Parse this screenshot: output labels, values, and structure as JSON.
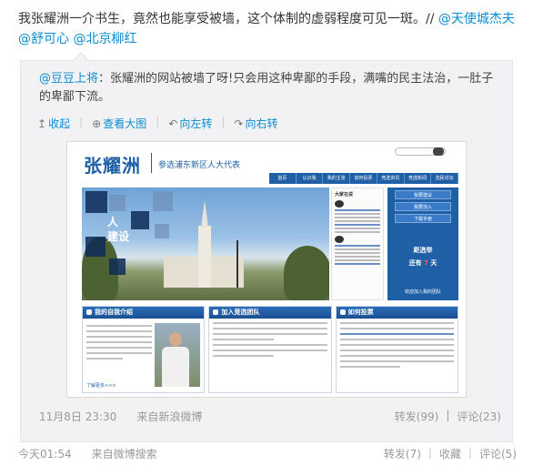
{
  "post": {
    "text": "我张耀洲一介书生，竟然也能享受被墙，这个体制的虚弱程度可见一斑。// ",
    "mention_1": "@天使城杰夫",
    "mention_2": "@舒可心",
    "mention_3": "@北京柳红"
  },
  "quote": {
    "author": "@豆豆上将",
    "text": "：张耀洲的网站被墙了呀!只会用这种卑鄙的手段，满嘴的民主法治，一肚子的卑鄙下流。"
  },
  "toolbar": {
    "collapse": "收起",
    "view_large": "查看大图",
    "rotate_left": "向左转",
    "rotate_right": "向右转"
  },
  "screenshot": {
    "logo": "张耀洲",
    "subtitle": "参选浦东新区人大代表",
    "nav": [
      "首页",
      "认识我",
      "我的主张",
      "如何投票",
      "竞选资讯",
      "竞选新闻",
      "选民论坛"
    ],
    "photo_caption_1": "人",
    "photo_caption_2": "建设",
    "news_head": "大家在说",
    "side_buttons": [
      "我要建议",
      "我要加入",
      "下载手册"
    ],
    "side_big_1": "距选举",
    "side_big_2a": "还有",
    "side_big_2b": "7",
    "side_big_2c": "天",
    "side_footer": "欢迎加入我的团队",
    "panel_1_title": "我的自我介绍",
    "panel_2_title": "加入竞选团队",
    "panel_3_title": "如何投票",
    "panel_more": "了解更多>>>"
  },
  "quote_meta": {
    "time": "11月8日 23:30",
    "source": "来自新浪微博",
    "repost": "转发(99)",
    "comment": "评论(23)"
  },
  "footer": {
    "time": "今天01:54",
    "source": "来自微博搜索",
    "repost": "转发(7)",
    "favorite": "收藏",
    "comment": "评论(5)"
  },
  "colors": {
    "link": "#0a8cd2",
    "quote_bg": "#f2f2f5",
    "site_blue": "#1e5fa6"
  }
}
